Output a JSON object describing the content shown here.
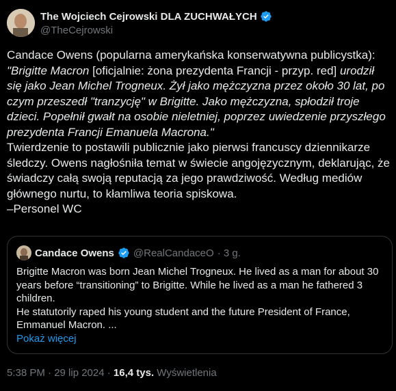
{
  "author": {
    "name": "The Wojciech Cejrowski DLA ZUCHWAŁYCH",
    "handle": "@TheCejrowski"
  },
  "tweet": {
    "intro": "Candace Owens (popularna amerykańska konserwatywna publicystka):",
    "quote_a": "\"Brigitte Macron ",
    "quote_note": "[oficjalnie: żona prezydenta Francji - przyp. red]",
    "quote_b": " urodził się jako Jean Michel Trogneux. Żył jako mężczyzna przez około 30 lat, po czym przeszedł \"tranzycję\" w Brigitte. Jako mężczyzna, spłodził troje dzieci. Popełnił gwałt na osobie nieletniej, poprzez uwiedzenie przyszłego prezydenta Francji Emanuela Macrona.\"",
    "body": "Twierdzenie to postawili publicznie jako pierwsi francuscy dziennikarze śledczy. Owens nagłośniła temat w świecie angojęzycznym, deklarując, że świadczy całą swoją reputacją za jego prawdziwość. Według mediów głównego nurtu, to kłamliwa teoria spiskowa.",
    "signature": "–Personel WC"
  },
  "quoted": {
    "name": "Candace Owens",
    "handle": "@RealCandaceO",
    "time": "· 3 g.",
    "line1": "Brigitte Macron was born Jean Michel Trogneux. He lived as a man for about 30 years before “transitioning” to Brigitte. While he lived as a man he fathered 3 children.",
    "line2": "He statutorily raped his young student and the future President of France, Emmanuel Macron.  ...",
    "more": "Pokaż więcej"
  },
  "meta": {
    "time": "5:38 PM · 29 lip 2024 · ",
    "views": "16,4 tys.",
    "views_label": " Wyświetlenia"
  },
  "colors": {
    "background": "#000000",
    "text": "#e7e9ea",
    "muted": "#71767b",
    "link": "#1d9bf0",
    "verified": "#1d9bf0",
    "border": "#2f3336"
  },
  "icons": [
    "verified-badge-icon"
  ]
}
